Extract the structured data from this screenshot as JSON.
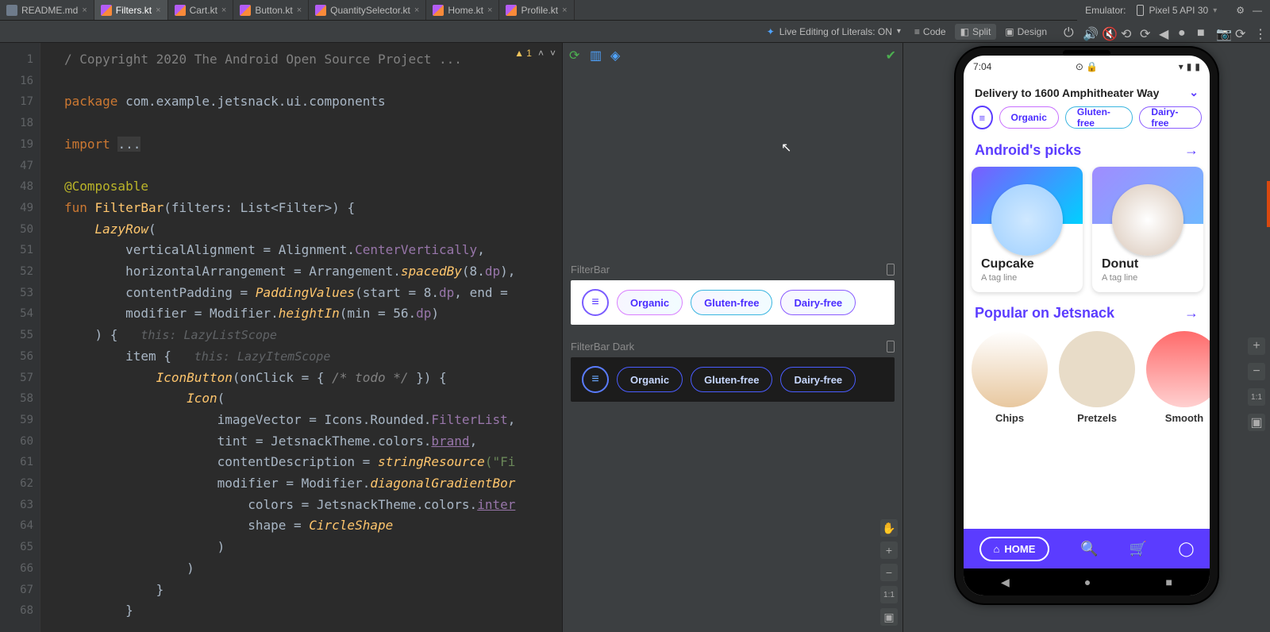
{
  "tabs": [
    {
      "label": "README.md",
      "active": false,
      "icon": "md"
    },
    {
      "label": "Filters.kt",
      "active": true,
      "icon": "kt"
    },
    {
      "label": "Cart.kt",
      "active": false,
      "icon": "kt"
    },
    {
      "label": "Button.kt",
      "active": false,
      "icon": "kt"
    },
    {
      "label": "QuantitySelector.kt",
      "active": false,
      "icon": "kt"
    },
    {
      "label": "Home.kt",
      "active": false,
      "icon": "kt"
    },
    {
      "label": "Profile.kt",
      "active": false,
      "icon": "kt"
    }
  ],
  "emulator": {
    "label": "Emulator:",
    "device": "Pixel 5 API 30"
  },
  "subbar": {
    "literals": "Live Editing of Literals: ON",
    "code": "Code",
    "split": "Split",
    "design": "Design"
  },
  "gutter": [
    "1",
    "16",
    "17",
    "18",
    "19",
    "47",
    "48",
    "49",
    "50",
    "51",
    "52",
    "53",
    "54",
    "55",
    "56",
    "57",
    "58",
    "59",
    "60",
    "61",
    "62",
    "63",
    "64",
    "65",
    "66",
    "67",
    "68"
  ],
  "ed_status": {
    "warn": "▲ 1"
  },
  "code": {
    "l1": "/ Copyright 2020 The Android Open Source Project ...",
    "pkg_kw": "package",
    "pkg": "com.example.jetsnack.ui.components",
    "imp_kw": "import",
    "imp_rest": "...",
    "ann": "@Composable",
    "fun_kw": "fun",
    "fun_name": "FilterBar",
    "fun_sig": "(filters: List<Filter>) {",
    "lazy": "LazyRow",
    "lazy_paren": "(",
    "p_va": "verticalAlignment",
    "eq": " = ",
    "align": "Alignment.",
    "cv": "CenterVertically",
    "comma": ",",
    "p_ha": "horizontalArrangement",
    "arr": "Arrangement.",
    "sb": "spacedBy",
    "sb_arg": "(8.",
    "dp": "dp",
    "close": "),",
    "p_cp": "contentPadding",
    "pv": "PaddingValues",
    "pv_arg_l": "(start",
    "pv_8": " = 8.",
    "pv_end": ", end",
    "pv_eq": " = ",
    "p_mod": "modifier",
    "modcl": "Modifier.",
    "hin": "heightIn",
    "hin_arg_l": "(min",
    "n56": " = 56.",
    "close_paren": ") {",
    "inl1": "this: LazyListScope",
    "item": "item",
    "item_b": " {",
    "inl2": "this: LazyItemScope",
    "ib": "IconButton",
    "ib_arg": "(onClick",
    "ib_lam": " = { ",
    "todo": "/* todo */",
    "ib_lam_e": " }) {",
    "icon": "Icon",
    "icon_p": "(",
    "iv": "imageVector",
    "ivs": "Icons.Rounded.",
    "fl": "FilterList",
    "tint": "tint",
    "jt": "JetsnackTheme.colors.",
    "brand": "brand",
    "cd": "contentDescription",
    "sr": "stringResource",
    "sr_arg": "(\"Fi",
    "modd": "modifier",
    "dgb": "diagonalGradientBor",
    "cols": "colors",
    "inter": "inter",
    "shape": "shape",
    "cs": "CircleShape",
    "cp": ")",
    "cb": "}"
  },
  "preview": {
    "light_label": "FilterBar",
    "dark_label": "FilterBar Dark",
    "chips": [
      "Organic",
      "Gluten-free",
      "Dairy-free"
    ]
  },
  "phone": {
    "time": "7:04",
    "delivery": "Delivery to 1600 Amphitheater Way",
    "filters": [
      "Organic",
      "Gluten-free",
      "Dairy-free"
    ],
    "section1": "Android's picks",
    "cards": [
      {
        "name": "Cupcake",
        "tag": "A tag line"
      },
      {
        "name": "Donut",
        "tag": "A tag line"
      }
    ],
    "section2": "Popular on Jetsnack",
    "circles": [
      "Chips",
      "Pretzels",
      "Smooth"
    ],
    "nav_home": "HOME"
  },
  "zoom": {
    "one": "1:1"
  }
}
